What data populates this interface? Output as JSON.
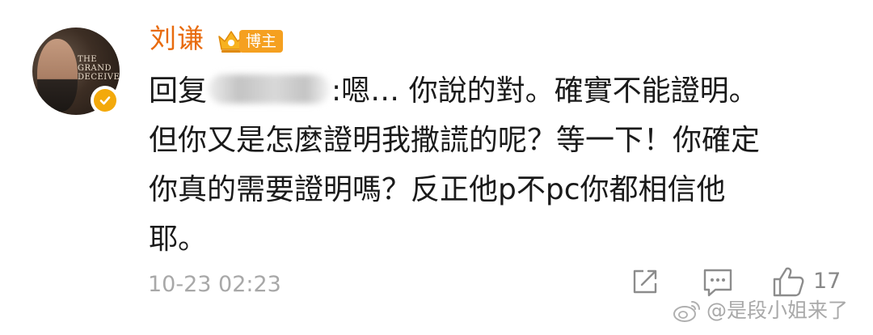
{
  "author": {
    "name": "刘谦",
    "tag": "博主",
    "avatar_text": [
      "THE",
      "GRAND",
      "DECEIVER"
    ]
  },
  "comment": {
    "reply_prefix": "回复",
    "line1_rest": ":嗯… 你說的對。確實不能證明。",
    "line2": "但你又是怎麼證明我撒謊的呢？等一下！你確定",
    "line3": "你真的需要證明嗎？反正他p不pc你都相信他",
    "line4": "耶。"
  },
  "meta": {
    "timestamp": "10-23 02:23",
    "like_count": "17"
  },
  "watermark": {
    "text": "@是段小姐来了"
  },
  "colors": {
    "username": "#e86b0e",
    "tag_bg": "#f5a020",
    "verified": "#f3a90b",
    "icon_gray": "#8c8c8c"
  },
  "icons": {
    "verified": "verified-icon",
    "crown": "crown-icon",
    "share": "share-icon",
    "comment": "comment-icon",
    "like": "thumbs-up-icon",
    "weibo": "weibo-logo-icon"
  }
}
